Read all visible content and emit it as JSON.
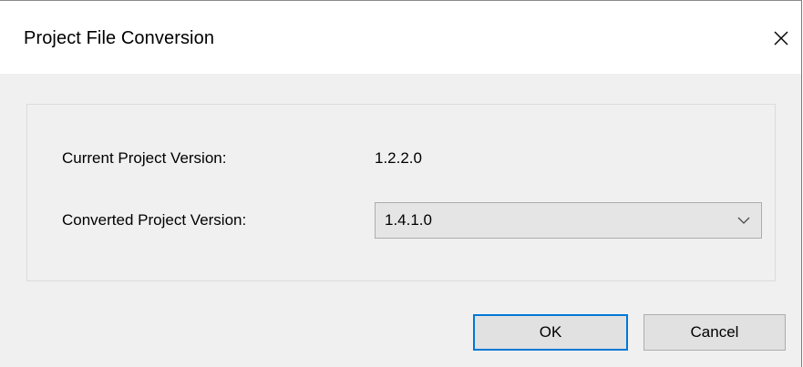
{
  "window": {
    "title": "Project File Conversion",
    "close_icon": "close-icon"
  },
  "form": {
    "current_label": "Current Project Version:",
    "current_value": "1.2.2.0",
    "converted_label": "Converted Project Version:",
    "converted_value": "1.4.1.0",
    "dropdown_icon": "chevron-down-icon"
  },
  "buttons": {
    "ok_label": "OK",
    "cancel_label": "Cancel"
  },
  "colors": {
    "titlebar": "#ffffff",
    "body": "#f0f0f0",
    "default_button_border": "#0078d7"
  }
}
